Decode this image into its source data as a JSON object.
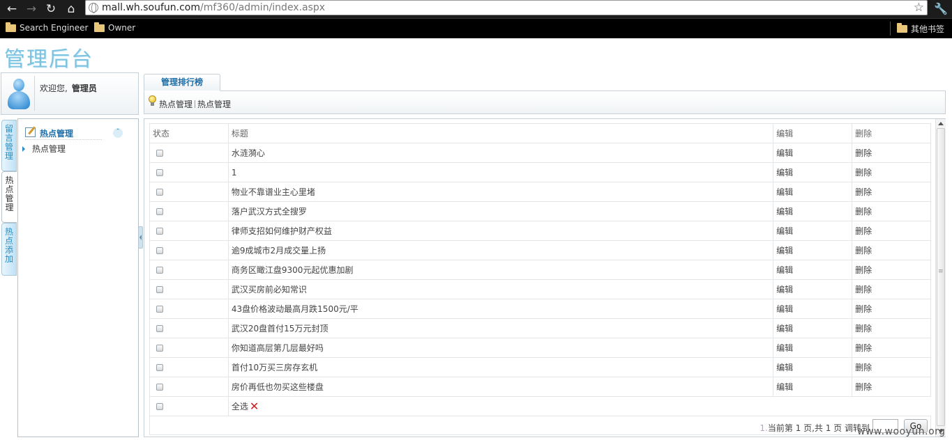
{
  "browser": {
    "url_host": "mall.wh.soufun.com",
    "url_path": "/mf360/admin/index.aspx",
    "bookmarks": [
      "Search Engineer",
      "Owner"
    ],
    "other_bookmarks": "其他书签"
  },
  "site": {
    "title": "管理后台"
  },
  "welcome": {
    "greeting": "欢迎您,",
    "user": "管理员"
  },
  "side_tabs": [
    {
      "label": "留言管理",
      "chars": [
        "留",
        "言",
        "管",
        "理"
      ],
      "active": false
    },
    {
      "label": "热点管理",
      "chars": [
        "热",
        "点",
        "管",
        "理"
      ],
      "active": true
    },
    {
      "label": "热点添加",
      "chars": [
        "热",
        "点",
        "添",
        "加"
      ],
      "active": false
    }
  ],
  "menu": {
    "title": "热点管理",
    "items": [
      "热点管理"
    ]
  },
  "content_tab": "管理排行榜",
  "breadcrumb": [
    "热点管理",
    "热点管理"
  ],
  "table": {
    "columns": [
      "状态",
      "标题",
      "编辑",
      "删除"
    ],
    "rows": [
      {
        "title": "水涟漪心",
        "edit": "编辑",
        "delete": "删除"
      },
      {
        "title": "1",
        "edit": "编辑",
        "delete": "删除"
      },
      {
        "title": "物业不靠谱业主心里堵",
        "edit": "编辑",
        "delete": "删除"
      },
      {
        "title": "落户武汉方式全搜罗",
        "edit": "编辑",
        "delete": "删除"
      },
      {
        "title": "律师支招如何维护财产权益",
        "edit": "编辑",
        "delete": "删除"
      },
      {
        "title": "逾9成城市2月成交量上扬",
        "edit": "编辑",
        "delete": "删除"
      },
      {
        "title": "商务区瞰江盘9300元起优惠加剧",
        "edit": "编辑",
        "delete": "删除"
      },
      {
        "title": "武汉买房前必知常识",
        "edit": "编辑",
        "delete": "删除"
      },
      {
        "title": "43盘价格波动最高月跌1500元/平",
        "edit": "编辑",
        "delete": "删除"
      },
      {
        "title": "武汉20盘首付15万元封顶",
        "edit": "编辑",
        "delete": "删除"
      },
      {
        "title": "你知道高层第几层最好吗",
        "edit": "编辑",
        "delete": "删除"
      },
      {
        "title": "首付10万买三房存玄机",
        "edit": "编辑",
        "delete": "删除"
      },
      {
        "title": "房价再低也勿买这些楼盘",
        "edit": "编辑",
        "delete": "删除"
      }
    ],
    "select_all": "全选"
  },
  "pager": {
    "page_number": "1.",
    "summary": "当前第 1 页,共 1 页 调转到",
    "go": "Go"
  },
  "watermark": "www.wooyun.org",
  "colors": {
    "title": "#7bc3e0",
    "accent": "#1e6fa8",
    "delete_x": "#d01818"
  }
}
